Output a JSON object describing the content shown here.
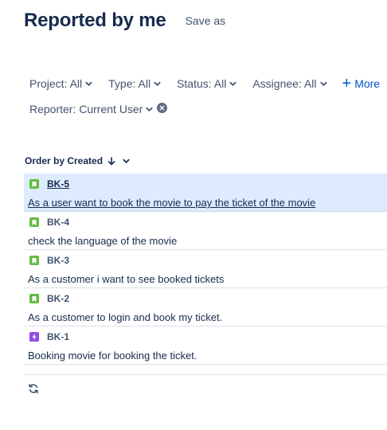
{
  "header": {
    "title": "Reported by me",
    "save_as": "Save as"
  },
  "filters": {
    "row1": [
      {
        "label": "Project: All"
      },
      {
        "label": "Type: All"
      },
      {
        "label": "Status: All"
      },
      {
        "label": "Assignee: All"
      }
    ],
    "more_label": "More",
    "reporter_label": "Reporter: Current User"
  },
  "order": {
    "label": "Order by Created",
    "direction_icon": "arrow-down-icon"
  },
  "colors": {
    "story": "#65ba43",
    "epic": "#904ee2",
    "accent": "#0052cc",
    "selected_bg": "#deebff"
  },
  "issues": [
    {
      "key": "BK-5",
      "summary": "As a user want to book the movie to pay the ticket of the movie",
      "type": "story",
      "selected": true
    },
    {
      "key": "BK-4",
      "summary": "check the language of the movie",
      "type": "story",
      "selected": false
    },
    {
      "key": "BK-3",
      "summary": "As a customer i want to see booked tickets",
      "type": "story",
      "selected": false
    },
    {
      "key": "BK-2",
      "summary": "As a customer to login and book my ticket.",
      "type": "story",
      "selected": false
    },
    {
      "key": "BK-1",
      "summary": "Booking movie for booking the ticket.",
      "type": "epic",
      "selected": false
    }
  ]
}
